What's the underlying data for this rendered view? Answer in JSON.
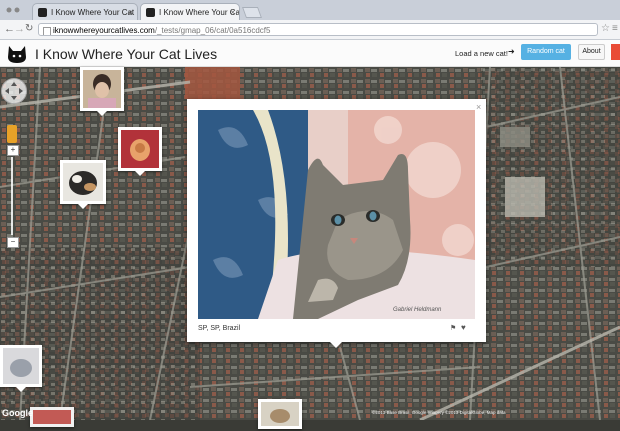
{
  "browser": {
    "tabs": [
      {
        "label": "I Know Where Your Cat Liv"
      },
      {
        "label": "I Know Where Your Cat Liv"
      }
    ],
    "url_domain": "iknowwhereyourcatlives.com",
    "url_path": "/_tests/gmap_06/cat/0a516cdcf5"
  },
  "header": {
    "title": "I Know Where Your Cat Lives",
    "load_text": "Load a new cat!",
    "arrow": "➜",
    "random_label": "Random cat",
    "about_label": "About"
  },
  "popup": {
    "location": "SP, SP, Brazil",
    "watermark": "Gabriel Heldmann",
    "close": "×"
  },
  "map": {
    "credit": "©2013 Base Brasil, Google Imagery ©2013 DigitalGlobe, Map data",
    "google_label": "Google"
  },
  "icons": [
    "cat-logo-icon",
    "pan-control-icon",
    "pegman-icon",
    "zoom-in-icon",
    "zoom-out-icon",
    "close-icon",
    "flag-icon",
    "heart-icon",
    "star-icon",
    "wrench-icon"
  ],
  "colors": {
    "accent": "#56b1e3",
    "red_button": "#e94b35",
    "pegman": "#e8a228"
  }
}
